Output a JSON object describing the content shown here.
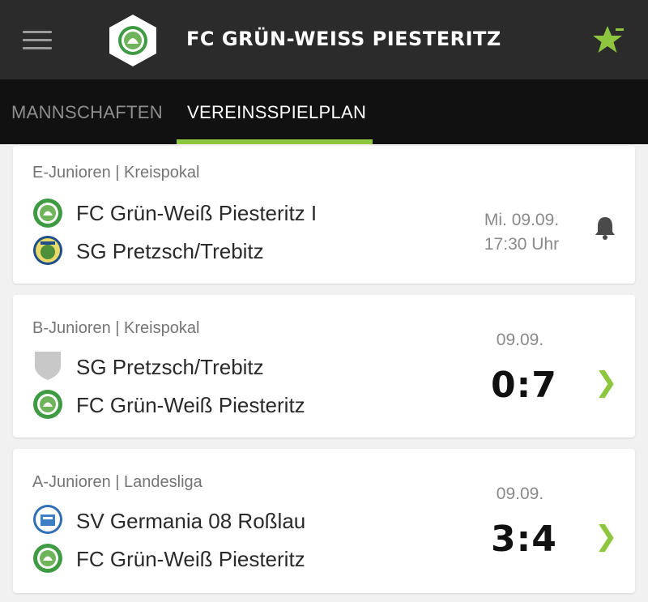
{
  "header": {
    "title": "FC GRÜN-WEISS PIESTERITZ",
    "menu_icon": "hamburger-menu-icon",
    "favorite_icon": "star-icon",
    "accent_color": "#8ec63f"
  },
  "tabs": [
    {
      "label": "MANNSCHAFTEN",
      "active": false
    },
    {
      "label": "VEREINSSPIELPLAN",
      "active": true
    }
  ],
  "matches": [
    {
      "competition": "E-Junioren | Kreispokal",
      "home": "FC Grün-Weiß Piesteritz I",
      "away": "SG Pretzsch/Trebitz",
      "date": "Mi. 09.09.",
      "time": "17:30 Uhr",
      "action_icon": "bell-icon"
    },
    {
      "competition": "B-Junioren | Kreispokal",
      "home": "SG Pretzsch/Trebitz",
      "away": "FC Grün-Weiß Piesteritz",
      "date": "09.09.",
      "score": "0:7",
      "action_icon": "chevron-right-icon"
    },
    {
      "competition": "A-Junioren | Landesliga",
      "home": "SV Germania 08 Roßlau",
      "away": "FC Grün-Weiß Piesteritz",
      "date": "09.09.",
      "score": "3:4",
      "action_icon": "chevron-right-icon"
    }
  ]
}
